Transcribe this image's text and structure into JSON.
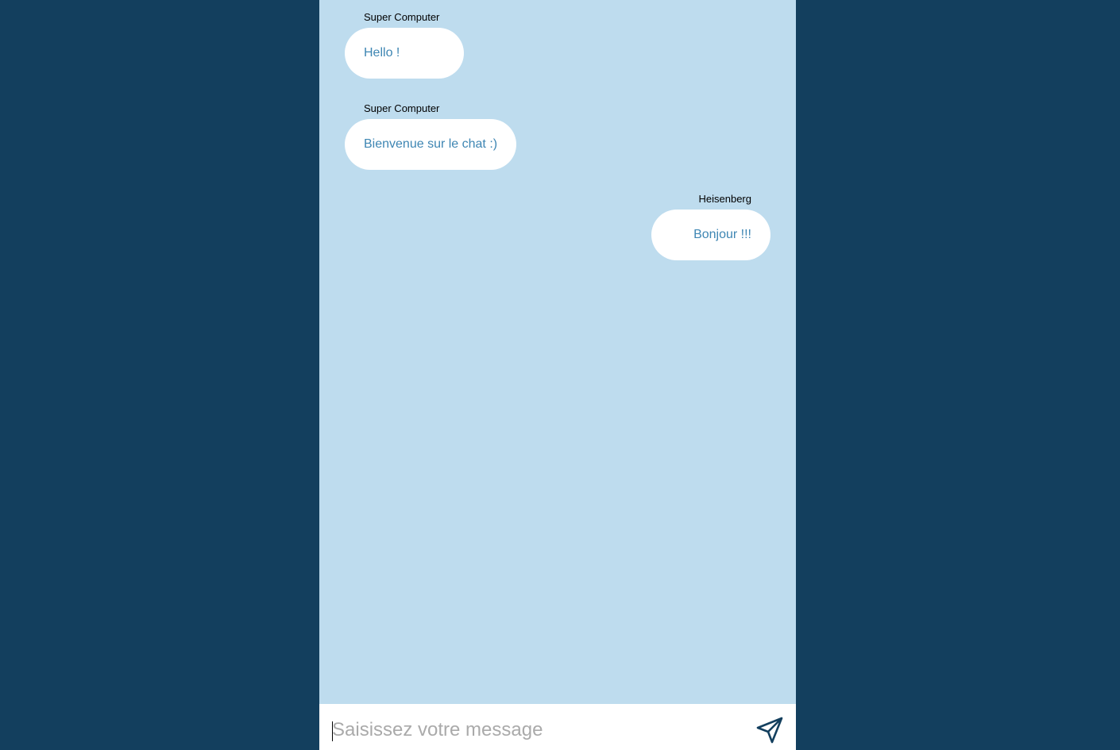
{
  "colors": {
    "page_background": "#133f5e",
    "chat_background": "#bedcee",
    "bubble_background": "#ffffff",
    "bubble_text": "#3e86b3",
    "sender_text": "#000000",
    "send_icon": "#133f5e"
  },
  "messages": [
    {
      "sender": "Super Computer",
      "text": "Hello !",
      "side": "left"
    },
    {
      "sender": "Super Computer",
      "text": "Bienvenue sur le chat :)",
      "side": "left"
    },
    {
      "sender": "Heisenberg",
      "text": "Bonjour !!!",
      "side": "right"
    }
  ],
  "composer": {
    "placeholder": "Saisissez votre message",
    "value": "",
    "send_icon": "send-icon"
  }
}
